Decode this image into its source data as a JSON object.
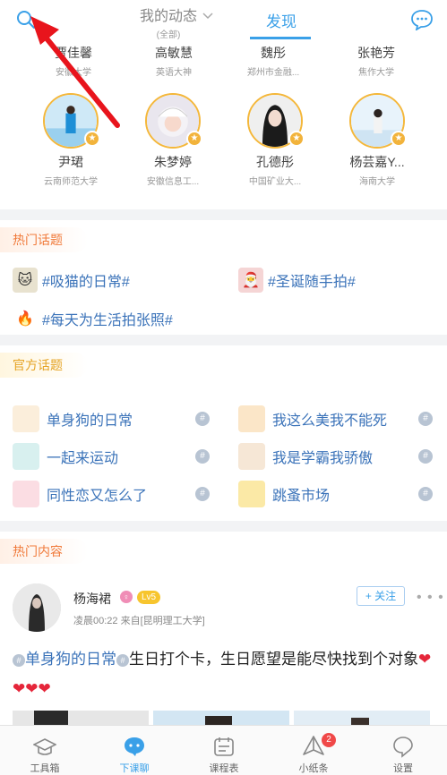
{
  "header": {
    "tab_dynamic": "我的动态",
    "tab_dynamic_sub": "(全部)",
    "tab_discover": "发现"
  },
  "people_row1": [
    {
      "name": "贾佳馨",
      "school": "安徽大学"
    },
    {
      "name": "高敏慧",
      "school": "英语大神"
    },
    {
      "name": "魏彤",
      "school": "郑州市金融..."
    },
    {
      "name": "张艳芳",
      "school": "焦作大学"
    }
  ],
  "people_row2": [
    {
      "name": "尹珺",
      "school": "云南师范大学"
    },
    {
      "name": "朱梦婷",
      "school": "安徽信息工..."
    },
    {
      "name": "孔德彤",
      "school": "中国矿业大..."
    },
    {
      "name": "杨芸嘉Y...",
      "school": "海南大学"
    }
  ],
  "hot_topics": {
    "title": "热门话题",
    "items": [
      {
        "label": "#吸猫的日常#",
        "icon": "cat-icon"
      },
      {
        "label": "#圣诞随手拍#",
        "icon": "santa-icon"
      },
      {
        "label": "#每天为生活拍张照#",
        "icon": "fire-icon"
      }
    ]
  },
  "official_topics": {
    "title": "官方话题",
    "items": [
      {
        "label": "单身狗的日常",
        "icon": "dog-icon"
      },
      {
        "label": "我这么美我不能死",
        "icon": "face-icon"
      },
      {
        "label": "一起来运动",
        "icon": "sneaker-icon"
      },
      {
        "label": "我是学霸我骄傲",
        "icon": "glasses-icon"
      },
      {
        "label": "同性恋又怎么了",
        "icon": "pig-icon"
      },
      {
        "label": "跳蚤市场",
        "icon": "money-bag-icon"
      }
    ]
  },
  "hot_content": {
    "title": "热门内容",
    "post": {
      "author": "杨海裙",
      "level": "Lv5",
      "time": "凌晨00:22",
      "source": "来自[昆明理工大学]",
      "follow_label": "+ 关注",
      "tag": "单身狗的日常",
      "text": "生日打个卡，生日愿望是能尽快找到个对象",
      "hearts": "❤❤❤❤"
    }
  },
  "tabbar": [
    {
      "label": "工具箱",
      "icon": "mortarboard-icon"
    },
    {
      "label": "下课聊",
      "icon": "chat-bubble-icon"
    },
    {
      "label": "课程表",
      "icon": "schedule-icon"
    },
    {
      "label": "小纸条",
      "icon": "paper-plane-icon",
      "badge": "2"
    },
    {
      "label": "设置",
      "icon": "settings-icon"
    }
  ],
  "colors": {
    "accent": "#3aa0e8",
    "topic": "#3b73b9",
    "hot": "#f07a3a",
    "official": "#e5a323",
    "badge": "#f04848",
    "annotation_arrow": "#e8141c"
  }
}
